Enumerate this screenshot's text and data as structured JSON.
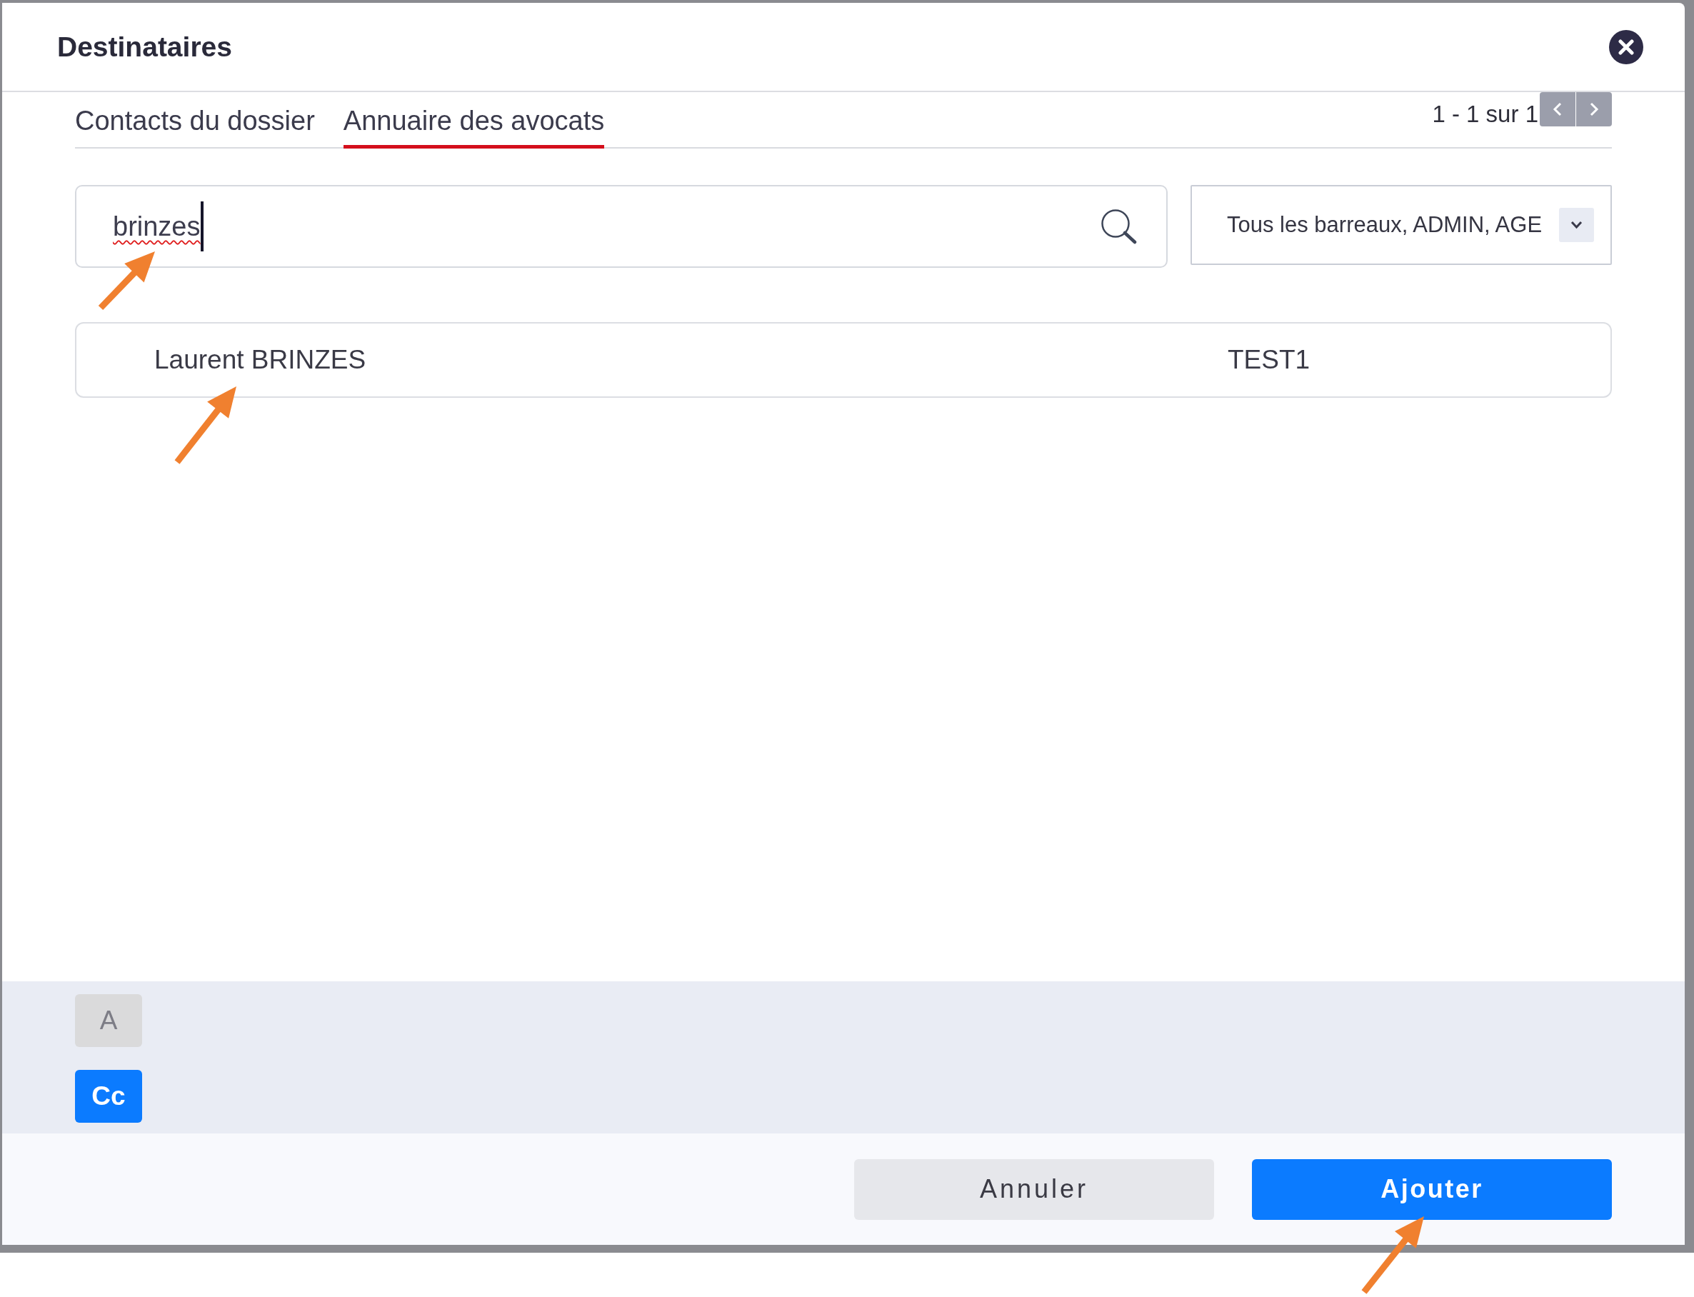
{
  "dialog": {
    "title": "Destinataires"
  },
  "tabs": [
    {
      "label": "Contacts du dossier",
      "selected": false
    },
    {
      "label": "Annuaire des avocats",
      "selected": true
    }
  ],
  "pagination": {
    "label": "1 - 1 sur 1"
  },
  "search": {
    "value": "brinzes"
  },
  "barreau_filter": {
    "value": "Tous les barreaux, ADMIN, AGE"
  },
  "results": [
    {
      "name": "Laurent BRINZES",
      "column_2": "TEST1",
      "selected": false
    }
  ],
  "recipient_types": [
    {
      "label": "A",
      "selected": false
    },
    {
      "label": "Cc",
      "selected": true
    }
  ],
  "buttons": [
    {
      "label": "Annuler",
      "kind": "secondary"
    },
    {
      "label": "Ajouter",
      "kind": "primary"
    }
  ]
}
